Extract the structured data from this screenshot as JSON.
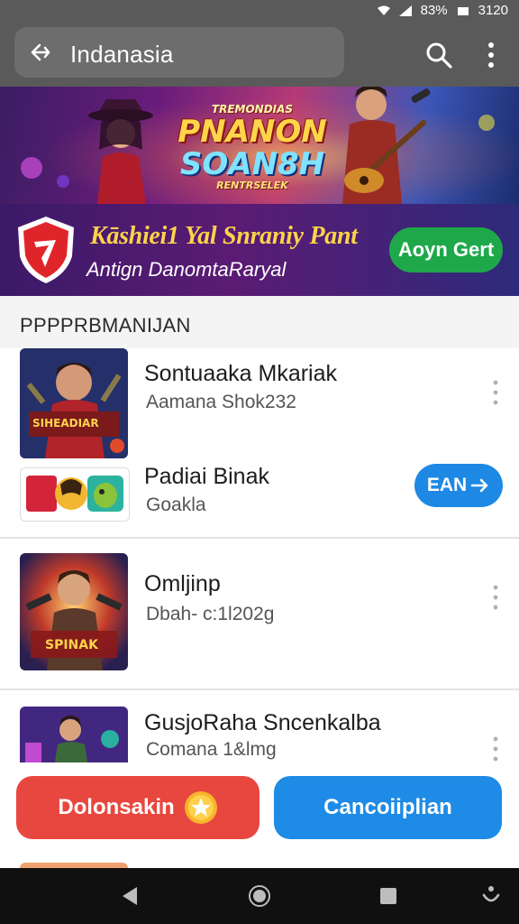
{
  "status_bar": {
    "battery": "83%",
    "time": "3120"
  },
  "app_bar": {
    "title": "Indanasia"
  },
  "banner": {
    "top_text": "TREMONDIAS",
    "title_line1": "PNANON",
    "title_line2": "SOAN8H",
    "tagline": "RENTRSELEK"
  },
  "promo": {
    "title": "Kāshiei1 Yal Snraniy Pant",
    "subtitle": "Antign DanomtaRaryal",
    "button": "Aoyn Gert"
  },
  "section": {
    "title": "PPPPRBMANIJAN"
  },
  "list": [
    {
      "title": "Sontuaaka Mkariak",
      "subtitle": "Aamana Shok232",
      "thumb_caption": "SIHEADIAR"
    },
    {
      "title": "Padiai Binak",
      "subtitle": "Goakla",
      "button": "EAN"
    },
    {
      "title": "Omljinp",
      "subtitle": "Dbah- c:1l202g",
      "thumb_caption": "SPINAK"
    },
    {
      "title": "GusjoRaha Sncenkalba",
      "subtitle": "Comana 1&lmg"
    }
  ],
  "actions": {
    "left": "Dolonsakin",
    "right": "Cancoiiplian"
  },
  "colors": {
    "green": "#1fa84a",
    "blue": "#1e88e5",
    "red": "#e8473f",
    "gold": "#ffd34a"
  },
  "icons": [
    "back-arrow-icon",
    "search-icon",
    "more-vert-icon",
    "shield-logo-icon",
    "arrow-right-icon",
    "star-coin-icon",
    "nav-back-icon",
    "nav-home-icon",
    "nav-recents-icon",
    "accessibility-icon"
  ]
}
